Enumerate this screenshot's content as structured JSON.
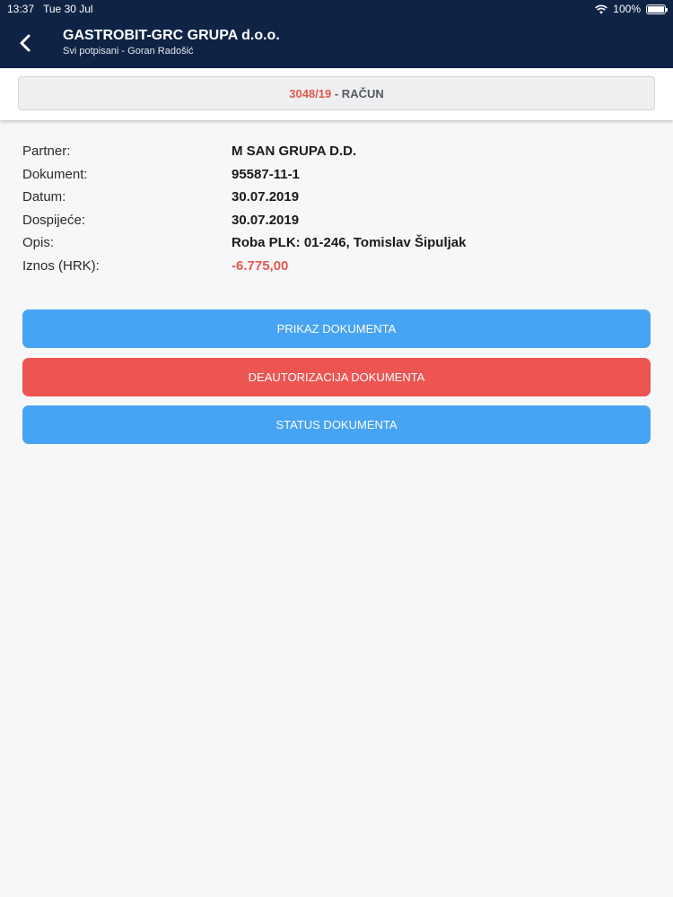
{
  "status_bar": {
    "time": "13:37",
    "date": "Tue 30 Jul",
    "battery": "100%"
  },
  "header": {
    "title": "GASTROBIT-GRC GRUPA d.o.o.",
    "subtitle": "Svi potpisani - Goran Radošić"
  },
  "document_bar": {
    "number": "3048/19",
    "type": " - RAČUN"
  },
  "details": {
    "partner_label": "Partner:",
    "partner_value": "M SAN GRUPA D.D.",
    "dokument_label": "Dokument:",
    "dokument_value": "95587-11-1",
    "datum_label": "Datum:",
    "datum_value": "30.07.2019",
    "dospijece_label": "Dospijeće:",
    "dospijece_value": "30.07.2019",
    "opis_label": "Opis:",
    "opis_value": "Roba PLK: 01-246, Tomislav Šipuljak",
    "iznos_label": "Iznos (HRK):",
    "iznos_value": "-6.775,00"
  },
  "actions": {
    "prikaz": "PRIKAZ DOKUMENTA",
    "deautorizacija": "DEAUTORIZACIJA DOKUMENTA",
    "status": "STATUS DOKUMENTA"
  },
  "colors": {
    "header_bg": "#0f2344",
    "accent_red": "#e05a4f",
    "button_blue": "#47a3f3",
    "button_red": "#ec5552"
  }
}
